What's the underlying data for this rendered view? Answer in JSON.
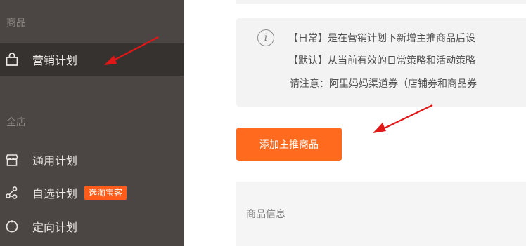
{
  "sidebar": {
    "section_goods": "商品",
    "section_shop": "全店",
    "items": [
      {
        "label": "营销计划",
        "icon": "shopping-bag-icon",
        "active": true
      },
      {
        "label": "通用计划",
        "icon": "store-icon"
      },
      {
        "label": "自选计划",
        "icon": "share-network-icon",
        "badge": "选淘宝客"
      },
      {
        "label": "定向计划",
        "icon": "target-icon"
      }
    ]
  },
  "notice": {
    "icon": "info-icon",
    "line1": "【日常】是在营销计划下新增主推商品后设",
    "line2": "【默认】从当前有效的日常策略和活动策略",
    "line3": "请注意：阿里妈妈渠道券（店铺券和商品券"
  },
  "main": {
    "add_button_label": "添加主推商品",
    "product_info_label": "商品信息"
  },
  "colors": {
    "sidebar_bg": "#4b4643",
    "sidebar_active_bg": "#363230",
    "accent": "#ff6a1f",
    "annotation_arrow": "#e11717"
  }
}
